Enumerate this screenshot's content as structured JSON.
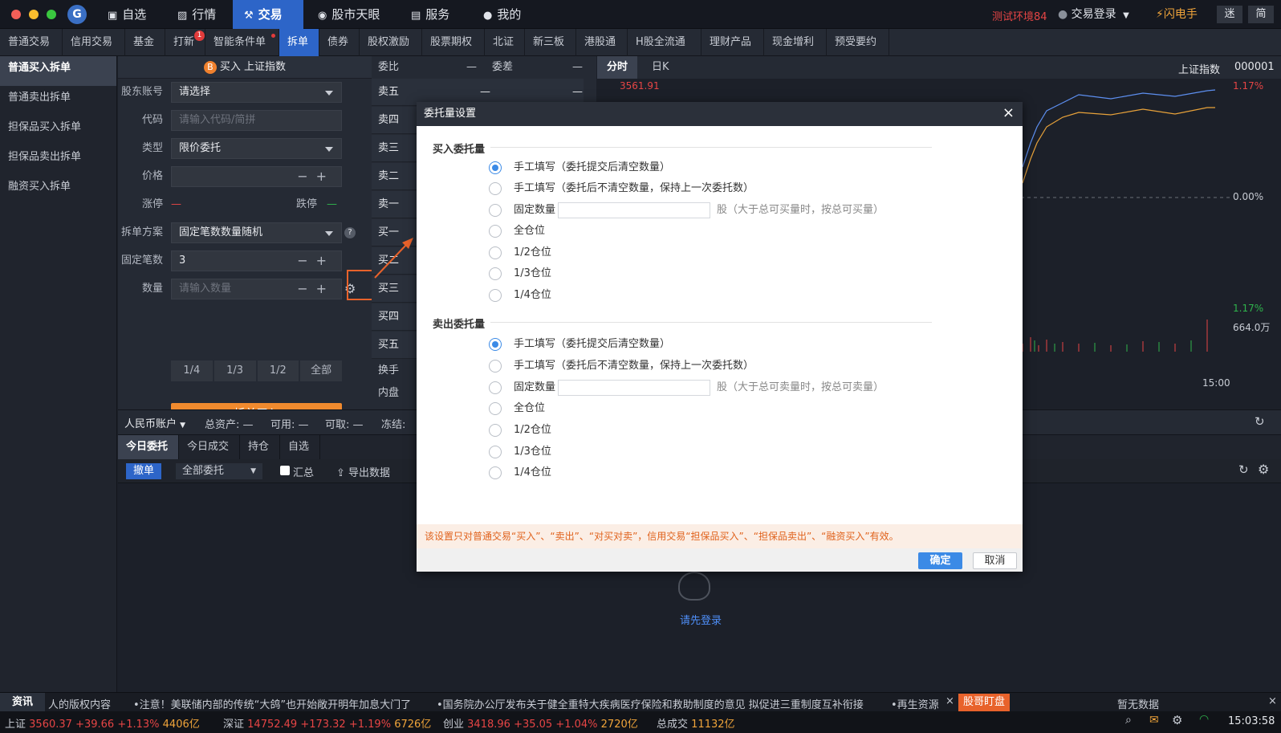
{
  "topbar": {
    "nav": [
      {
        "label": "自选",
        "icon": "star-icon"
      },
      {
        "label": "行情",
        "icon": "chart-icon"
      },
      {
        "label": "交易",
        "icon": "hammer-icon"
      },
      {
        "label": "股市天眼",
        "icon": "eye-icon"
      },
      {
        "label": "服务",
        "icon": "briefcase-icon"
      },
      {
        "label": "我的",
        "icon": "person-icon"
      }
    ],
    "env_label": "测试环境84",
    "login_label": "交易登录",
    "flash_label": "闪电手",
    "mini_label": "迷",
    "simple_label": "简"
  },
  "subnav": [
    {
      "label": "普通交易"
    },
    {
      "label": "信用交易"
    },
    {
      "label": "基金"
    },
    {
      "label": "打新",
      "badge": "1"
    },
    {
      "label": "智能条件单"
    },
    {
      "label": "拆单"
    },
    {
      "label": "债券"
    },
    {
      "label": "股权激励"
    },
    {
      "label": "股票期权"
    },
    {
      "label": "北证"
    },
    {
      "label": "新三板"
    },
    {
      "label": "港股通"
    },
    {
      "label": "H股全流通"
    },
    {
      "label": "理财产品"
    },
    {
      "label": "现金增利"
    },
    {
      "label": "预受要约"
    }
  ],
  "sidebar": {
    "items": [
      "普通买入拆单",
      "普通卖出拆单",
      "担保品买入拆单",
      "担保品卖出拆单",
      "融资买入拆单"
    ]
  },
  "form": {
    "title_badge": "B",
    "title": "买入 上证指数",
    "account_label": "股东账号",
    "account_value": "请选择",
    "code_label": "代码",
    "code_placeholder": "请输入代码/简拼",
    "type_label": "类型",
    "type_value": "限价委托",
    "price_label": "价格",
    "limit_up_label": "涨停",
    "limit_up_value": "—",
    "limit_down_label": "跌停",
    "limit_down_value": "—",
    "plan_label": "拆单方案",
    "plan_value": "固定笔数数量随机",
    "fixed_count_label": "固定笔数",
    "fixed_count_value": "3",
    "qty_label": "数量",
    "qty_placeholder": "请输入数量",
    "fractions": [
      "1/4",
      "1/3",
      "1/2",
      "全部"
    ],
    "submit_label": "拆单买入"
  },
  "orderbook": {
    "ratio_label": "委比",
    "ratio_value": "—",
    "diff_label": "委差",
    "diff_value": "—",
    "rows": [
      "卖五",
      "卖四",
      "卖三",
      "卖二",
      "卖一",
      "买一",
      "买二",
      "买三",
      "买四",
      "买五"
    ],
    "row_value": "—",
    "extra": [
      "换手",
      "内盘"
    ]
  },
  "chart_panel": {
    "tabs": [
      "分时",
      "日K"
    ],
    "index_name": "上证指数",
    "index_code": "000001",
    "price_top": "3561.91",
    "pct_top": "1.17%",
    "pct_mid": "0.00%",
    "pct_bottom": "1.17%",
    "volume": "664.0万",
    "time_end": "15:00"
  },
  "account_bar": {
    "currency": "人民币账户",
    "total_label": "总资产:",
    "total_value": "—",
    "avail_label": "可用:",
    "avail_value": "—",
    "withdraw_label": "可取:",
    "withdraw_value": "—",
    "frozen_label": "冻结:"
  },
  "order_tabs": [
    "今日委托",
    "今日成交",
    "持仓",
    "自选"
  ],
  "toolbar": {
    "cancel_label": "撤单",
    "filter_value": "全部委托",
    "summary_label": "汇总",
    "export_label": "导出数据"
  },
  "empty": {
    "login_prompt": "请先登录"
  },
  "news": {
    "label": "资讯",
    "items": [
      "人的版权内容",
      "•注意！美联储内部的传统“大鸽”也开始敞开明年加息大门了",
      "•国务院办公厅发布关于健全重特大疾病医疗保险和救助制度的意见 拟促进三重制度互补衔接",
      "•再生资源"
    ],
    "tag": "股哥盯盘",
    "no_data": "暂无数据"
  },
  "status": {
    "indices": [
      {
        "name": "上证",
        "value": "3560.37",
        "change": "+39.66",
        "pct": "+1.13%",
        "turnover": "4406亿"
      },
      {
        "name": "深证",
        "value": "14752.49",
        "change": "+173.32",
        "pct": "+1.19%",
        "turnover": "6726亿"
      },
      {
        "name": "创业",
        "value": "3418.96",
        "change": "+35.05",
        "pct": "+1.04%",
        "turnover": "2720亿"
      }
    ],
    "total_label": "总成交",
    "total_value": "11132亿",
    "time": "15:03:58"
  },
  "dialog": {
    "title": "委托量设置",
    "buy_section": "买入委托量",
    "buy_options": [
      "手工填写（委托提交后清空数量）",
      "手工填写（委托后不清空数量，保持上一次委托数）",
      "固定数量",
      "全仓位",
      "1/2仓位",
      "1/3仓位",
      "1/4仓位"
    ],
    "buy_hint": "股（大于总可买量时，按总可买量）",
    "sell_section": "卖出委托量",
    "sell_options": [
      "手工填写（委托提交后清空数量）",
      "手工填写（委托后不清空数量，保持上一次委托数）",
      "固定数量",
      "全仓位",
      "1/2仓位",
      "1/3仓位",
      "1/4仓位"
    ],
    "sell_hint": "股（大于总可卖量时，按总可卖量）",
    "notice": "该设置只对普通交易“买入”、“卖出”、“对买对卖”，信用交易“担保品买入”、“担保品卖出”、“融资买入”有效。",
    "ok_label": "确定",
    "cancel_label": "取消"
  },
  "colors": {
    "accent": "#2d65c8",
    "orange": "#f08a2e",
    "up": "#e64545",
    "down": "#2fb44c"
  }
}
